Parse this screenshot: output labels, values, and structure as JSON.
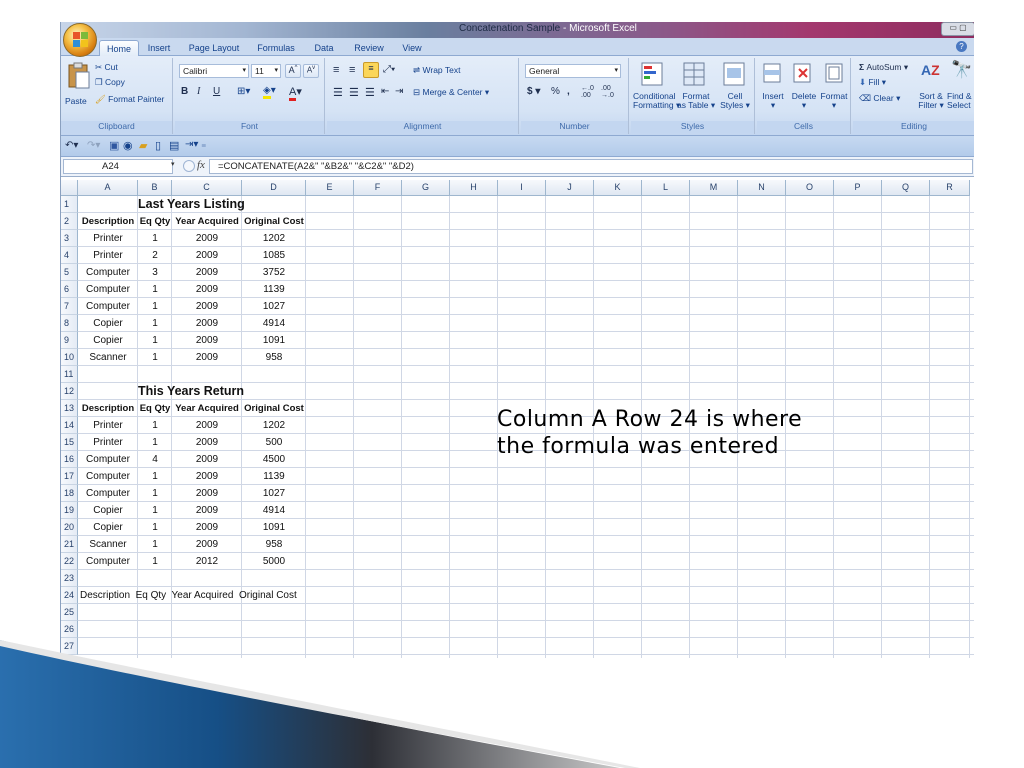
{
  "window": {
    "title_left": "Concatenation Sample",
    "title_right": " - Microsoft Excel"
  },
  "tabs": [
    "Home",
    "Insert",
    "Page Layout",
    "Formulas",
    "Data",
    "Review",
    "View"
  ],
  "ribbon": {
    "clipboard": {
      "paste": "Paste",
      "cut": "Cut",
      "copy": "Copy",
      "format_painter": "Format Painter",
      "label": "Clipboard"
    },
    "font": {
      "name": "Calibri",
      "size": "11",
      "bold": "B",
      "italic": "I",
      "underline": "U",
      "label": "Font"
    },
    "alignment": {
      "wrap_text": "Wrap Text",
      "merge_center": "Merge & Center",
      "label": "Alignment"
    },
    "number": {
      "format": "General",
      "currency": "$",
      "percent": "%",
      "comma": ",",
      "label": "Number"
    },
    "styles": {
      "conditional": "Conditional",
      "conditional2": "Formatting",
      "format_table": "Format",
      "format_table2": "as Table",
      "cell_styles": "Cell",
      "cell_styles2": "Styles",
      "label": "Styles"
    },
    "cells": {
      "insert": "Insert",
      "delete": "Delete",
      "format": "Format",
      "label": "Cells"
    },
    "editing": {
      "autosum": "AutoSum",
      "fill": "Fill",
      "clear": "Clear",
      "sort": "Sort &",
      "sort2": "Filter",
      "find": "Find &",
      "find2": "Select",
      "label": "Editing"
    }
  },
  "formula_bar": {
    "name_box": "A24",
    "fx": "fx",
    "formula": "=CONCATENATE(A2&\"  \"&B2&\"  \"&C2&\"  \"&D2)"
  },
  "columns": [
    "A",
    "B",
    "C",
    "D",
    "E",
    "F",
    "G",
    "H",
    "I",
    "J",
    "K",
    "L",
    "M",
    "N",
    "O",
    "P",
    "Q",
    "R"
  ],
  "rows": [
    "1",
    "2",
    "3",
    "4",
    "5",
    "6",
    "7",
    "8",
    "9",
    "10",
    "11",
    "12",
    "13",
    "14",
    "15",
    "16",
    "17",
    "18",
    "19",
    "20",
    "21",
    "22",
    "23",
    "24",
    "25",
    "26",
    "27"
  ],
  "sheet": {
    "title1": "Last Years Listing",
    "title2": "This Years Return",
    "headers": [
      "Description",
      "Eq Qty",
      "Year Acquired",
      "Original Cost"
    ],
    "last_year": [
      [
        "Printer",
        "1",
        "2009",
        "1202"
      ],
      [
        "Printer",
        "2",
        "2009",
        "1085"
      ],
      [
        "Computer",
        "3",
        "2009",
        "3752"
      ],
      [
        "Computer",
        "1",
        "2009",
        "1139"
      ],
      [
        "Computer",
        "1",
        "2009",
        "1027"
      ],
      [
        "Copier",
        "1",
        "2009",
        "4914"
      ],
      [
        "Copier",
        "1",
        "2009",
        "1091"
      ],
      [
        "Scanner",
        "1",
        "2009",
        "958"
      ]
    ],
    "this_year": [
      [
        "Printer",
        "1",
        "2009",
        "1202"
      ],
      [
        "Printer",
        "1",
        "2009",
        "500"
      ],
      [
        "Computer",
        "4",
        "2009",
        "4500"
      ],
      [
        "Computer",
        "1",
        "2009",
        "1139"
      ],
      [
        "Computer",
        "1",
        "2009",
        "1027"
      ],
      [
        "Copier",
        "1",
        "2009",
        "4914"
      ],
      [
        "Copier",
        "1",
        "2009",
        "1091"
      ],
      [
        "Scanner",
        "1",
        "2009",
        "958"
      ],
      [
        "Computer",
        "1",
        "2012",
        "5000"
      ]
    ],
    "row24": "Description  Eq Qty  Year Acquired  Original Cost"
  },
  "annotation": {
    "line1": "Column A Row 24 is where",
    "line2": "the formula was entered"
  },
  "colors": {
    "accent": "#15428b",
    "ribbon": "#d5e3f5",
    "swoosh": "#1a5d97"
  }
}
